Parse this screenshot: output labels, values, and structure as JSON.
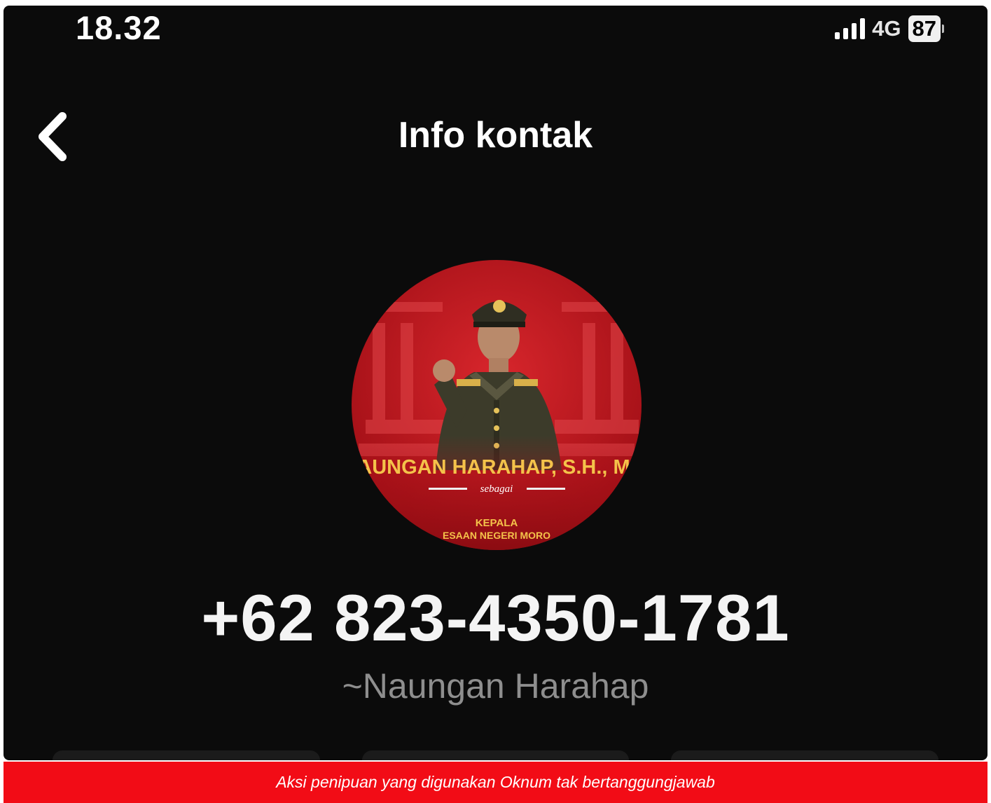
{
  "status_bar": {
    "time": "18.32",
    "network": "4G",
    "battery": "87",
    "icons": [
      "signal-icon",
      "battery-icon"
    ]
  },
  "header": {
    "back_icon": "chevron-left-icon",
    "title": "Info kontak"
  },
  "contact": {
    "avatar": {
      "banner_name": "AUNGAN HARAHAP, S.H., M.",
      "banner_script": "sebagai",
      "banner_role": "KEPALA",
      "banner_office": "ESAAN NEGERI MORO"
    },
    "phone_number": "+62 823-4350-1781",
    "display_name": "~Naungan Harahap"
  },
  "caption": "Aksi penipuan yang digunakan Oknum tak bertanggungjawab",
  "colors": {
    "background": "#0b0b0b",
    "caption_bar": "#f20c16",
    "avatar_red": "#c8151c",
    "banner_gold": "#f4c24a"
  }
}
